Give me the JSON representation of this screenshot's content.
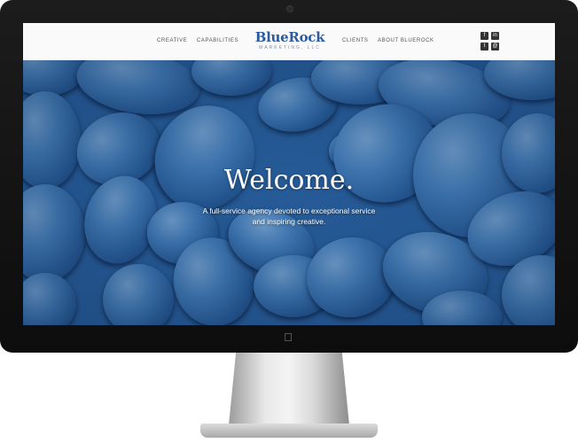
{
  "nav": {
    "creative": "CREATIVE",
    "capabilities": "CAPABILITIES",
    "clients": "CLIENTS",
    "about": "ABOUT BLUEROCK"
  },
  "logo": {
    "name": "BlueRock",
    "sub": "MARKETING, LLC"
  },
  "social": {
    "facebook": "f",
    "linkedin": "in",
    "twitter": "t",
    "email": "@"
  },
  "hero": {
    "heading": "Welcome.",
    "tagline": "A full-service agency devoted to exceptional service and inspiring creative."
  },
  "colors": {
    "brand": "#2c5b9e",
    "hero_base": "#2b66a8"
  },
  "icons": {
    "device_logo": "apple-icon"
  }
}
